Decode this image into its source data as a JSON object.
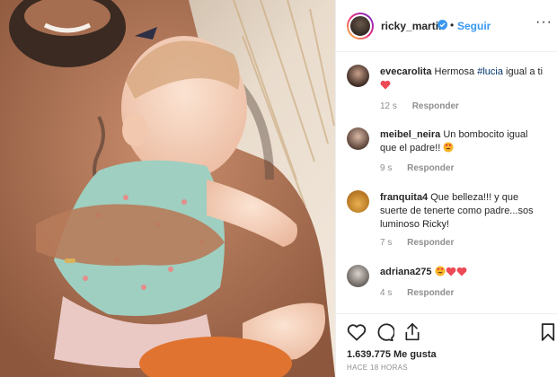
{
  "post": {
    "username": "ricky_martin",
    "follow_label": "Seguir",
    "separator": "•",
    "more_label": "···"
  },
  "comments": [
    {
      "user": "evecarolita",
      "text_before": "Hermosa ",
      "tag": "#lucia",
      "text_after": " igual a ti",
      "emojis": [
        "red-heart-icon"
      ],
      "time": "12 s",
      "reply": "Responder"
    },
    {
      "user": "meibel_neira",
      "text_before": "Un bombocito igual que el padre!!",
      "tag": "",
      "text_after": "",
      "emojis": [
        "heart-eyes-emoji-icon"
      ],
      "time": "9 s",
      "reply": "Responder"
    },
    {
      "user": "franquita4",
      "text_before": "Que belleza!!! y que suerte de tenerte como padre...sos luminoso Ricky!",
      "tag": "",
      "text_after": "",
      "emojis": [],
      "time": "7 s",
      "reply": "Responder"
    },
    {
      "user": "adriana275",
      "text_before": "",
      "tag": "",
      "text_after": "",
      "emojis": [
        "heart-eyes-emoji-icon",
        "red-heart-icon",
        "red-heart-icon"
      ],
      "time": "4 s",
      "reply": "Responder"
    }
  ],
  "footer": {
    "likes_count": "1.639.775",
    "likes_label": "Me gusta",
    "posted_ago": "HACE 18 HORAS"
  },
  "colors": {
    "link_blue": "#3897f0",
    "verified_blue": "#3897f0",
    "heart_red": "#ed4956",
    "muted": "#8e8e8e"
  }
}
